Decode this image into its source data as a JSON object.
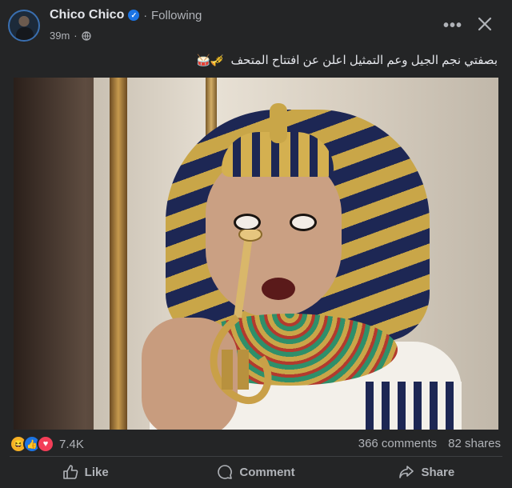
{
  "post": {
    "author": "Chico Chico",
    "verified_icon": "verified-badge-icon",
    "separator": "·",
    "follow_status": "Following",
    "time": "39m",
    "dot": "·",
    "privacy_icon": "globe-icon",
    "caption": "بصفتي نجم الجيل وعم التمثيل اعلن عن افتتاح المتحف",
    "caption_emojis": "🎺🥁",
    "more_label": "•••",
    "close_icon": "close-icon"
  },
  "media": {
    "description_icon": "video-thumbnail"
  },
  "engagement": {
    "reaction_icons": [
      "haha-icon",
      "like-icon",
      "love-icon"
    ],
    "haha": "😆",
    "like": "👍",
    "love": "♥",
    "reaction_count": "7.4K",
    "comments": "366 comments",
    "shares": "82 shares"
  },
  "actions": {
    "like": "Like",
    "comment": "Comment",
    "share": "Share"
  },
  "colors": {
    "background": "#242526",
    "text": "#e4e6eb",
    "muted": "#b0b3b8",
    "accent": "#1b74e4"
  }
}
